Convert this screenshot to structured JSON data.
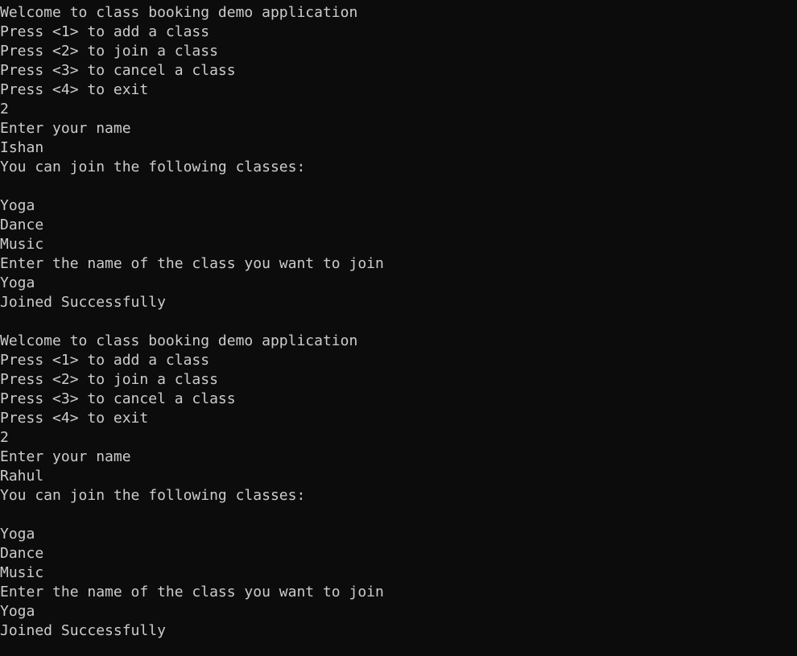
{
  "console": {
    "background": "#0c0c0c",
    "foreground": "#cccccc",
    "lines": [
      "Welcome to class booking demo application",
      "Press <1> to add a class",
      "Press <2> to join a class",
      "Press <3> to cancel a class",
      "Press <4> to exit",
      "2",
      "Enter your name",
      "Ishan",
      "You can join the following classes:",
      "",
      "Yoga",
      "Dance",
      "Music",
      "Enter the name of the class you want to join",
      "Yoga",
      "Joined Successfully",
      "",
      "Welcome to class booking demo application",
      "Press <1> to add a class",
      "Press <2> to join a class",
      "Press <3> to cancel a class",
      "Press <4> to exit",
      "2",
      "Enter your name",
      "Rahul",
      "You can join the following classes:",
      "",
      "Yoga",
      "Dance",
      "Music",
      "Enter the name of the class you want to join",
      "Yoga",
      "Joined Successfully"
    ]
  }
}
